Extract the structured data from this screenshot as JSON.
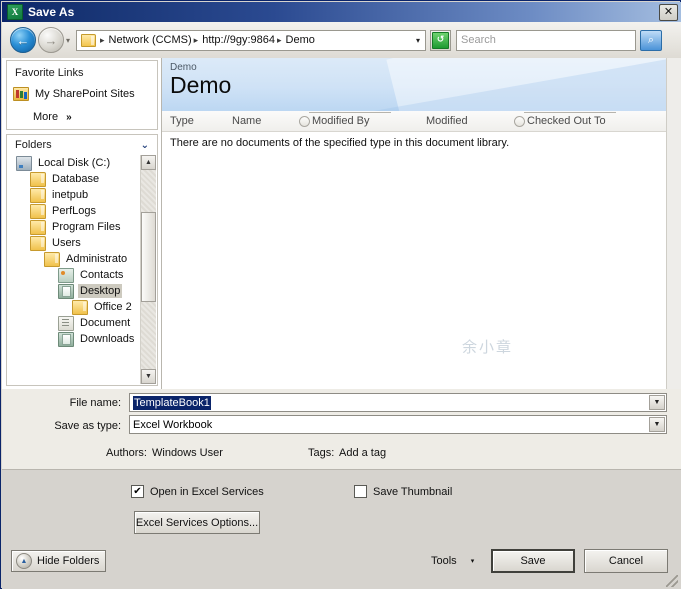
{
  "window": {
    "title": "Save As",
    "icon": "excel-icon",
    "close_label": "✕"
  },
  "address_bar": {
    "back_glyph": "←",
    "forward_glyph": "→",
    "history_caret": "▾",
    "crumbs": [
      "Network (CCMS)",
      "http://9gy:9864",
      "Demo"
    ],
    "crumb_separator": "▸",
    "crumb_caret": "▾",
    "refresh_glyph": "↺",
    "search_placeholder": "Search",
    "search_go_glyph": "⌕"
  },
  "sidebar": {
    "favorites_title": "Favorite Links",
    "favorites": [
      {
        "label": "My SharePoint Sites",
        "icon": "sharepoint-folder-icon"
      }
    ],
    "more_label": "More",
    "more_chevron": "»",
    "folders_title": "Folders",
    "folders_chevron": "⌄",
    "tree": [
      {
        "label": "Local Disk (C:)",
        "icon": "drive-icon",
        "indent": 0,
        "selected": false
      },
      {
        "label": "Database",
        "icon": "folder-icon",
        "indent": 1,
        "selected": false
      },
      {
        "label": "inetpub",
        "icon": "folder-icon",
        "indent": 1,
        "selected": false
      },
      {
        "label": "PerfLogs",
        "icon": "folder-icon",
        "indent": 1,
        "selected": false
      },
      {
        "label": "Program Files",
        "icon": "folder-icon",
        "indent": 1,
        "selected": false
      },
      {
        "label": "Users",
        "icon": "folder-icon",
        "indent": 1,
        "selected": false
      },
      {
        "label": "Administrato",
        "icon": "folder-icon",
        "indent": 2,
        "selected": false
      },
      {
        "label": "Contacts",
        "icon": "contacts-icon",
        "indent": 3,
        "selected": false
      },
      {
        "label": "Desktop",
        "icon": "desktop-icon",
        "indent": 3,
        "selected": true
      },
      {
        "label": "Office 2",
        "icon": "folder-icon",
        "indent": 4,
        "selected": false
      },
      {
        "label": "Document",
        "icon": "documents-icon",
        "indent": 3,
        "selected": false
      },
      {
        "label": "Downloads",
        "icon": "downloads-icon",
        "indent": 3,
        "selected": false
      }
    ],
    "scroll_up_glyph": "▲",
    "scroll_down_glyph": "▼"
  },
  "library": {
    "breadcrumb": "Demo",
    "title": "Demo",
    "columns": [
      {
        "label": "Type",
        "radio": false
      },
      {
        "label": "Name",
        "radio": false
      },
      {
        "label": "Modified By",
        "radio": true
      },
      {
        "label": "Modified",
        "radio": false
      },
      {
        "label": "Checked Out To",
        "radio": true
      }
    ],
    "empty_message": "There are no documents of the specified type in this document library.",
    "watermark": "余小章"
  },
  "form": {
    "filename_label": "File name:",
    "filename_value": "TemplateBook1",
    "savetype_label": "Save as type:",
    "savetype_value": "Excel Workbook",
    "dropdown_caret": "▼",
    "authors_label": "Authors:",
    "authors_value": "Windows User",
    "tags_label": "Tags:",
    "tags_value": "Add a tag"
  },
  "options": {
    "open_in_excel_services": {
      "label": "Open in Excel Services",
      "checked": true,
      "check_glyph": "✔"
    },
    "save_thumbnail": {
      "label": "Save Thumbnail",
      "checked": false,
      "check_glyph": ""
    },
    "excel_services_options_button": "Excel Services Options..."
  },
  "footer": {
    "hide_folders_label": "Hide Folders",
    "hide_folders_glyph": "▲",
    "tools_label": "Tools",
    "tools_caret": "▾",
    "save_label": "Save",
    "cancel_label": "Cancel"
  }
}
